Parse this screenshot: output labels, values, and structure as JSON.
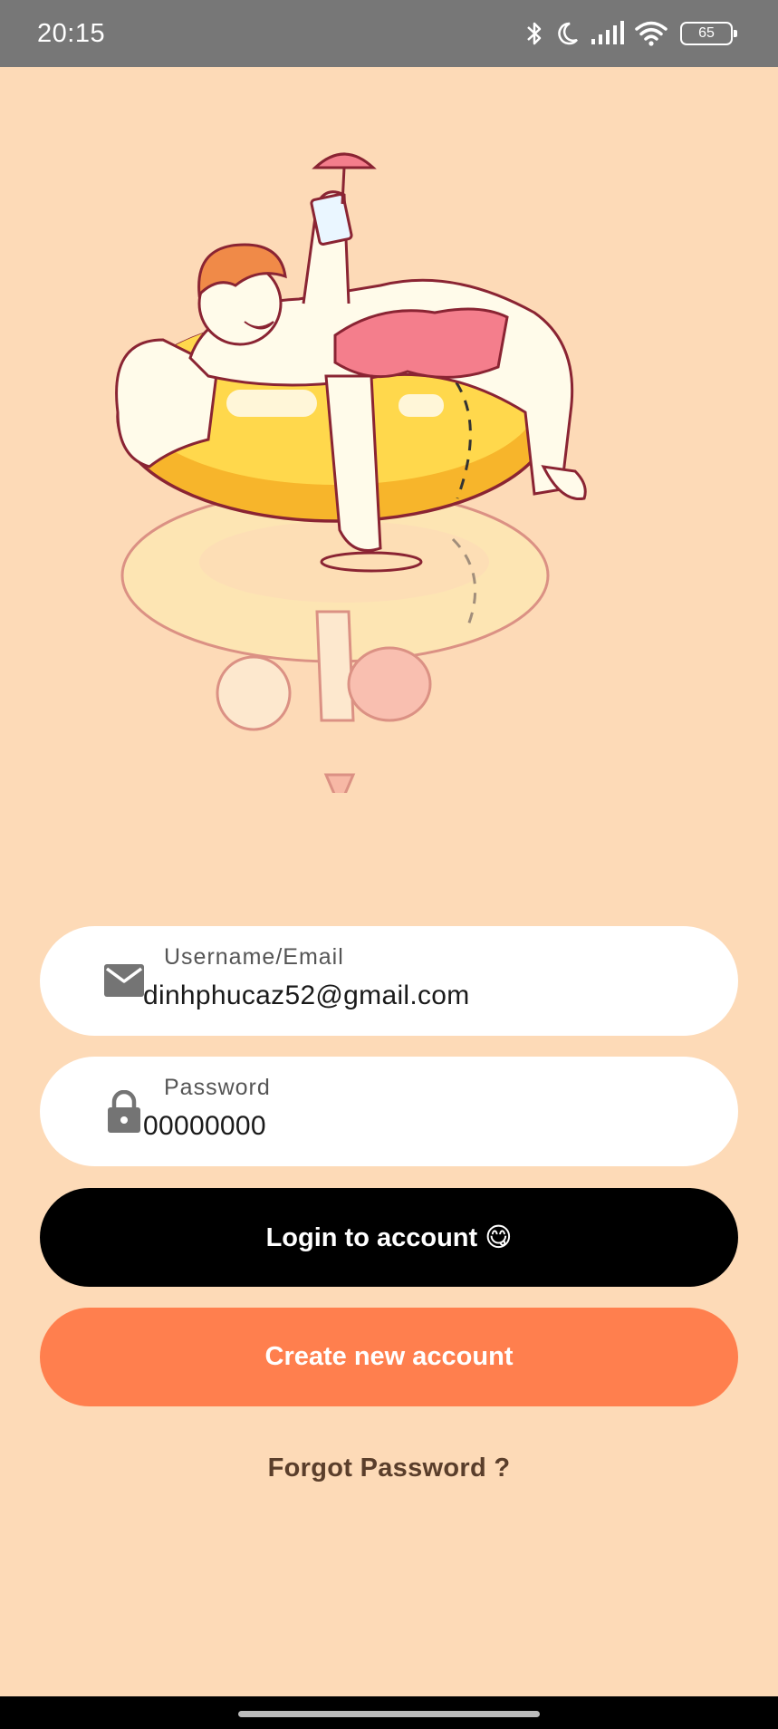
{
  "status_bar": {
    "time": "20:15",
    "battery": "65",
    "icons": [
      "bluetooth-icon",
      "moon-icon",
      "signal-icon",
      "wifi-icon",
      "battery-icon"
    ]
  },
  "illustration": {
    "subject": "man-relaxing-on-yellow-swim-ring"
  },
  "form": {
    "username": {
      "label": "Username/Email",
      "value": "dinhphucaz52@gmail.com",
      "icon": "mail-icon"
    },
    "password": {
      "label": "Password",
      "value": "00000000",
      "icon": "lock-icon"
    }
  },
  "buttons": {
    "login": "Login to account 😋",
    "create": "Create new account",
    "forgot": "Forgot Password ?"
  },
  "colors": {
    "background": "#FDDAB7",
    "login_button": "#000000",
    "create_button": "#FF7F4E",
    "status_bar": "#777777"
  }
}
